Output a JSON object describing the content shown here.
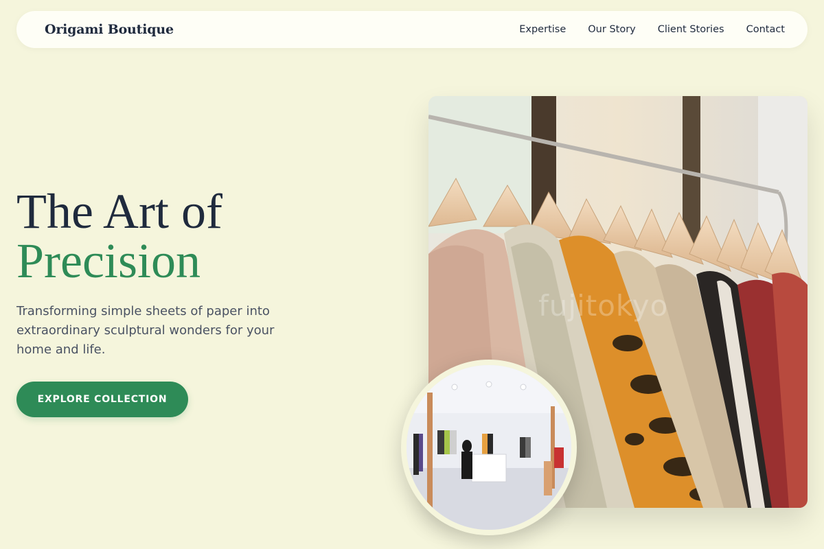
{
  "brand": {
    "name": "Origami Boutique"
  },
  "nav": {
    "items": [
      {
        "label": "Expertise"
      },
      {
        "label": "Our Story"
      },
      {
        "label": "Client Stories"
      },
      {
        "label": "Contact"
      }
    ]
  },
  "hero": {
    "title_line1": "The Art of",
    "title_line2": "Precision",
    "subtitle": "Transforming simple sheets of paper into extraordinary sculptural wonders for your home and life.",
    "cta_label": "EXPLORE COLLECTION"
  },
  "images": {
    "main_watermark": "fujitokyo"
  },
  "colors": {
    "background": "#f5f5dc",
    "accent": "#2e8b57",
    "text_dark": "#1f2a3d",
    "text_muted": "#4a5263"
  },
  "icons": {
    "main_image": "clothing-rack-photo",
    "inset_image": "boutique-store-interior-photo"
  }
}
